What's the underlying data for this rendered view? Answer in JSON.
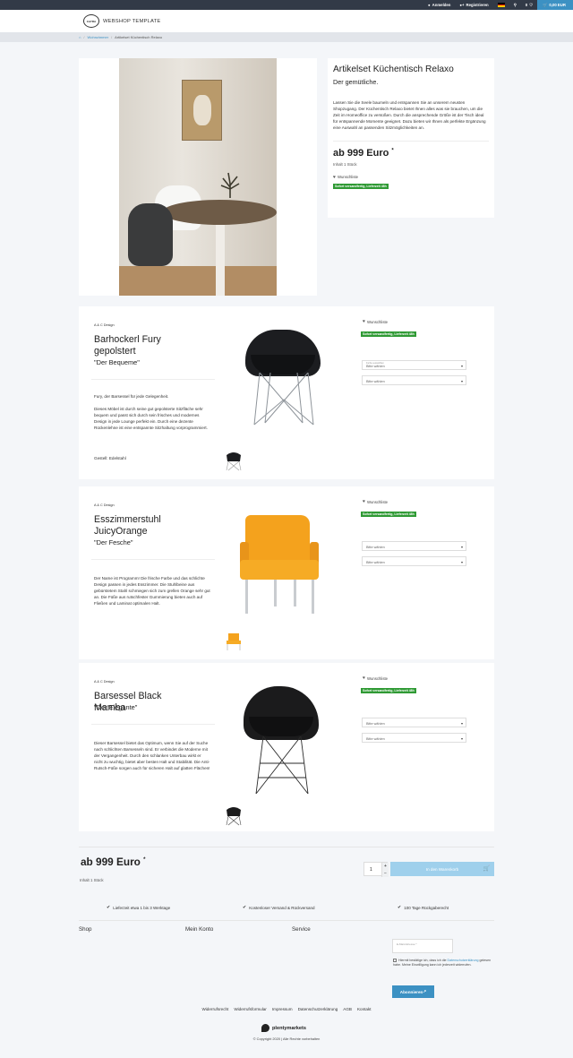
{
  "topbar": {
    "login": "Anmelden",
    "register": "Registrieren",
    "wishlist_count": "0",
    "cart_total": "0,00 EUR"
  },
  "header": {
    "logo_mark": "CAYRA",
    "logo_text": "WEBSHOP TEMPLATE"
  },
  "breadcrumb": {
    "items": [
      "Wohnzimmer",
      "Artikelset Küchentisch Relaxo"
    ]
  },
  "set": {
    "title": "Artikelset Küchentisch Relaxo",
    "subtitle": "Der gemütliche.",
    "description": "Lassen Sie die Seele baumeln und entspannen Sie an unserem neusten Shopzugang. Der Küchentisch Relaxo bietet Ihnen alles was sie brauchen, um die Zeit im Homeoffice zu versüßen. Durch die ansprechende Größe ist der Tisch ideal für entspannende Momente geeignet. Dazu bieten wir Ihnen als perfekte Ergänzung eine Auswahl an passenden Sitzmöglichkeiten an.",
    "price": "ab 999 Euro",
    "price_star": "*",
    "inhalt": "Inhalt 1 Stück",
    "wishlist": "Wunschliste",
    "availability": "Sofort versandfertig, Lieferzeit 48h"
  },
  "products": [
    {
      "brand": "A & C Design",
      "name": "Barhockerl Fury gepolstert",
      "slogan": "\"Der Bequeme\"",
      "description": "Fury, der Barsessel für jede Gelegenheit.",
      "description2": "Dieses Möbel ist durch seine gut gepolsterte Sitzfläche sehr bequem und passt sich durch sein frisches und modernes Design in jede Lounge perfekt ein. Durch eine dezente Rückenlehne ist eine entspannte Sitzhaltung vorprogrammiert.",
      "extra": "Gestell: Edelstahl",
      "wishlist": "Wunschliste",
      "availability": "Sofort versandfertig, Lieferzeit 48h",
      "select1_label": "Farbe auswählen",
      "select1_value": "Bitte wählen",
      "select2_label": "",
      "select2_value": "Bitte wählen"
    },
    {
      "brand": "A & C Design",
      "name": "Esszimmerstuhl JuicyOrange",
      "slogan": "\"Der Fesche\"",
      "description": "Der Name ist Programm! Die frische Farbe und das schlichte Design passen in jedes Esszimmer. Die Stuhlbeine aus gebürstetem Stahl schmiegen sich zum grellen Orange sehr gut an. Die Füße aus rutschfester Gummierung bieten auch auf Fließen und Laminat optimalen Halt.",
      "wishlist": "Wunschliste",
      "availability": "Sofort versandfertig, Lieferzeit 48h",
      "select1_label": "",
      "select1_value": "Bitte wählen",
      "select2_label": "",
      "select2_value": "Bitte wählen"
    },
    {
      "brand": "A & C Design",
      "name": "Barsessel Black Mamba",
      "slogan": "\"Der Elegante\"",
      "description": "Dieser Barsessel bietet das Optimum, wenn Sie auf der Suche nach schlichten Barsesseln sind. Er verbindet die Moderne mit der Vergangenheit. Durch den schlanken Unterbau wirkt er nicht zu wuchtig, bietet aber besten Halt und Stabilität. Die Anti-Rutsch-Füße sorgen auch für sicheren Halt auf glatten Flächen!",
      "wishlist": "Wunschliste",
      "availability": "Sofort versandfertig, Lieferzeit 48h",
      "select1_label": "",
      "select1_value": "Bitte wählen",
      "select2_label": "",
      "select2_value": "Bitte wählen"
    }
  ],
  "buy": {
    "price": "ab 999 Euro",
    "price_star": "*",
    "inhalt": "Inhalt 1 Stück",
    "quantity": "1",
    "plus": "+",
    "minus": "−",
    "add_to_cart": "In den Warenkorb"
  },
  "usps": [
    "Lieferzeit etwa 1 bis 3 Werktage",
    "Kostenloser Versand & Rückversand",
    "100 Tage Rückgaberecht"
  ],
  "footer": {
    "col_shop": "Shop",
    "col_account": "Mein Konto",
    "col_service": "Service",
    "email_label": "E-Mail-Adresse *",
    "consent_text": "Hiermit bestätige ich, dass ich die",
    "consent_link": "Datenschutzerklärung",
    "consent_rest": "gelesen habe. Meine Einwilligung kann ich jederzeit widerrufen.",
    "subscribe": "Abonnieren",
    "legal_links": [
      "Widerrufsrecht",
      "Widerrufsformular",
      "Impressum",
      "Datenschutzerklärung",
      "AGB",
      "Kontakt"
    ],
    "brand": "plentymarkets",
    "copyright": "© Copyright 2020 | Alle Rechte vorbehalten"
  },
  "colors": {
    "accent": "#3c91c3",
    "topbar": "#323a47",
    "availability": "#2f9a34",
    "cart_button": "#9fd0ec"
  }
}
